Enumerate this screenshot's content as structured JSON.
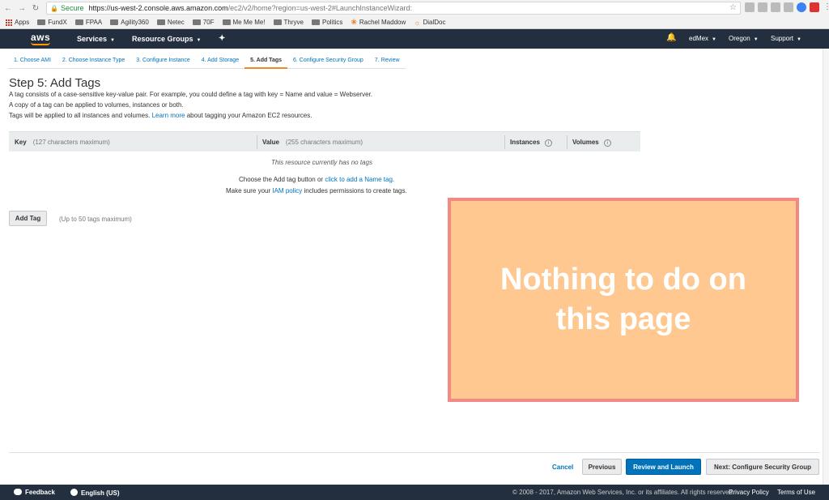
{
  "browser": {
    "secure_label": "Secure",
    "url_host": "https://us-west-2.console.aws.amazon.com",
    "url_path": "/ec2/v2/home?region=us-west-2#LaunchInstanceWizard:",
    "bookmarks": [
      "Apps",
      "FundX",
      "FPAA",
      "Agility360",
      "Netec",
      "70F",
      "Me Me Me!",
      "Thryve",
      "Politics",
      "Rachel Maddow",
      "DialDoc"
    ]
  },
  "aws_header": {
    "logo": "aws",
    "services": "Services",
    "resource_groups": "Resource Groups",
    "user": "edMex",
    "region": "Oregon",
    "support": "Support"
  },
  "wizard": {
    "tabs": [
      {
        "label": "1. Choose AMI"
      },
      {
        "label": "2. Choose Instance Type"
      },
      {
        "label": "3. Configure Instance"
      },
      {
        "label": "4. Add Storage"
      },
      {
        "label": "5. Add Tags"
      },
      {
        "label": "6. Configure Security Group"
      },
      {
        "label": "7. Review"
      }
    ],
    "active_tab": 4
  },
  "main": {
    "title": "Step 5: Add Tags",
    "desc1": "A tag consists of a case-sensitive key-value pair. For example, you could define a tag with key = Name and value = Webserver.",
    "desc2": "A copy of a tag can be applied to volumes, instances or both.",
    "desc3_pre": "Tags will be applied to all instances and volumes.",
    "desc3_link": "Learn more",
    "desc3_post": "about tagging your Amazon EC2 resources."
  },
  "table": {
    "key_header": "Key",
    "key_hint": "(127 characters maximum)",
    "value_header": "Value",
    "value_hint": "(255 characters maximum)",
    "instances_header": "Instances",
    "volumes_header": "Volumes",
    "empty_message": "This resource currently has no tags"
  },
  "empty_help": {
    "line1_pre": "Choose the Add tag button or",
    "line1_link": "click to add a Name tag",
    "line1_post": ".",
    "line2_pre": "Make sure your",
    "line2_link": "IAM policy",
    "line2_post": "includes permissions to create tags."
  },
  "actions": {
    "add_tag": "Add Tag",
    "add_tag_note": "(Up to 50 tags maximum)",
    "cancel": "Cancel",
    "previous": "Previous",
    "review_launch": "Review and Launch",
    "next": "Next: Configure Security Group"
  },
  "overlay": {
    "text": "Nothing to do on this page"
  },
  "footer": {
    "feedback": "Feedback",
    "language": "English (US)",
    "copyright": "© 2008 - 2017, Amazon Web Services, Inc. or its affiliates. All rights reserved.",
    "privacy": "Privacy Policy",
    "terms": "Terms of Use"
  }
}
